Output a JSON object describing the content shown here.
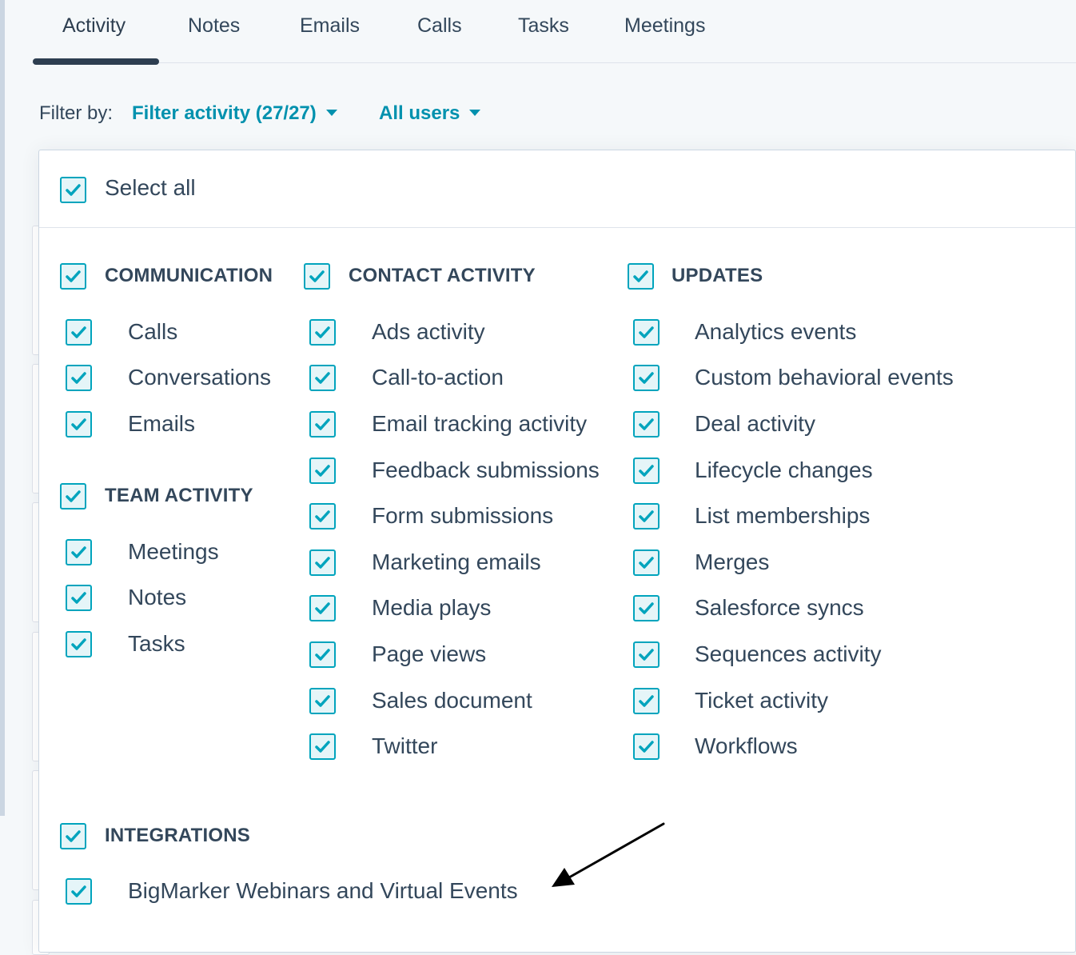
{
  "tabs": [
    {
      "label": "Activity",
      "active": true
    },
    {
      "label": "Notes"
    },
    {
      "label": "Emails"
    },
    {
      "label": "Calls"
    },
    {
      "label": "Tasks"
    },
    {
      "label": "Meetings"
    }
  ],
  "filter": {
    "label": "Filter by:",
    "activity_filter": "Filter activity (27/27)",
    "users_filter": "All users"
  },
  "panel": {
    "select_all": "Select all",
    "groups": {
      "communication": {
        "heading": "COMMUNICATION",
        "items": [
          "Calls",
          "Conversations",
          "Emails"
        ]
      },
      "team_activity": {
        "heading": "TEAM ACTIVITY",
        "items": [
          "Meetings",
          "Notes",
          "Tasks"
        ]
      },
      "contact_activity": {
        "heading": "CONTACT ACTIVITY",
        "items": [
          "Ads activity",
          "Call-to-action",
          "Email tracking activity",
          "Feedback submissions",
          "Form submissions",
          "Marketing emails",
          "Media plays",
          "Page views",
          "Sales document",
          "Twitter"
        ]
      },
      "updates": {
        "heading": "UPDATES",
        "items": [
          "Analytics events",
          "Custom behavioral events",
          "Deal activity",
          "Lifecycle changes",
          "List memberships",
          "Merges",
          "Salesforce syncs",
          "Sequences activity",
          "Ticket activity",
          "Workflows"
        ]
      },
      "integrations": {
        "heading": "INTEGRATIONS",
        "items": [
          "BigMarker Webinars and Virtual Events"
        ]
      }
    }
  },
  "colors": {
    "accent": "#00a4bd",
    "link": "#0091ae",
    "text": "#33475b",
    "tab_active": "#2d3e50"
  }
}
